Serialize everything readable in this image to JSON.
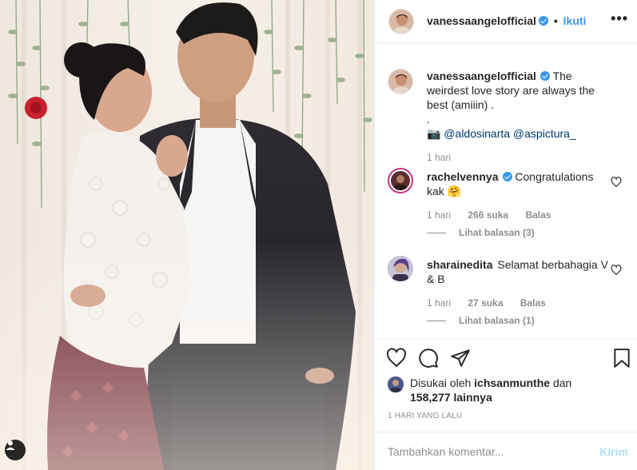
{
  "post": {
    "photo_alt": "couple photo",
    "user_tag_icon": "user-icon"
  },
  "header": {
    "username": "vanessaangelofficial",
    "separator": "•",
    "follow_label": "Ikuti",
    "more_label": "•••"
  },
  "caption": {
    "username": "vanessaangelofficial",
    "text": "The weirdest love story are always the best (amiiin) .",
    "dot": ".",
    "camera_icon": "📷",
    "mentions": "@aldosinarta @aspictura_",
    "time": "1 hari"
  },
  "comments": [
    {
      "username": "rachelvennya",
      "text": "Congratulations kak 🤗",
      "time": "1 hari",
      "likes": "266 suka",
      "reply_label": "Balas",
      "view_replies": "Lihat balasan (3)"
    },
    {
      "username": "sharainedita",
      "text": "Selamat berbahagia V & B",
      "time": "1 hari",
      "likes": "27 suka",
      "reply_label": "Balas",
      "view_replies": "Lihat balasan (1)"
    }
  ],
  "likes": {
    "prefix": "Disukai oleh",
    "user": "ichsanmunthe",
    "conj": "dan",
    "count": "158,277 lainnya"
  },
  "time_ago": "1 HARI YANG LALU",
  "add_comment": {
    "placeholder": "Tambahkan komentar...",
    "post_label": "Kirim"
  },
  "colors": {
    "accent": "#3897f0",
    "muted": "#8e8e8e",
    "post_disabled": "#b2dffc"
  }
}
